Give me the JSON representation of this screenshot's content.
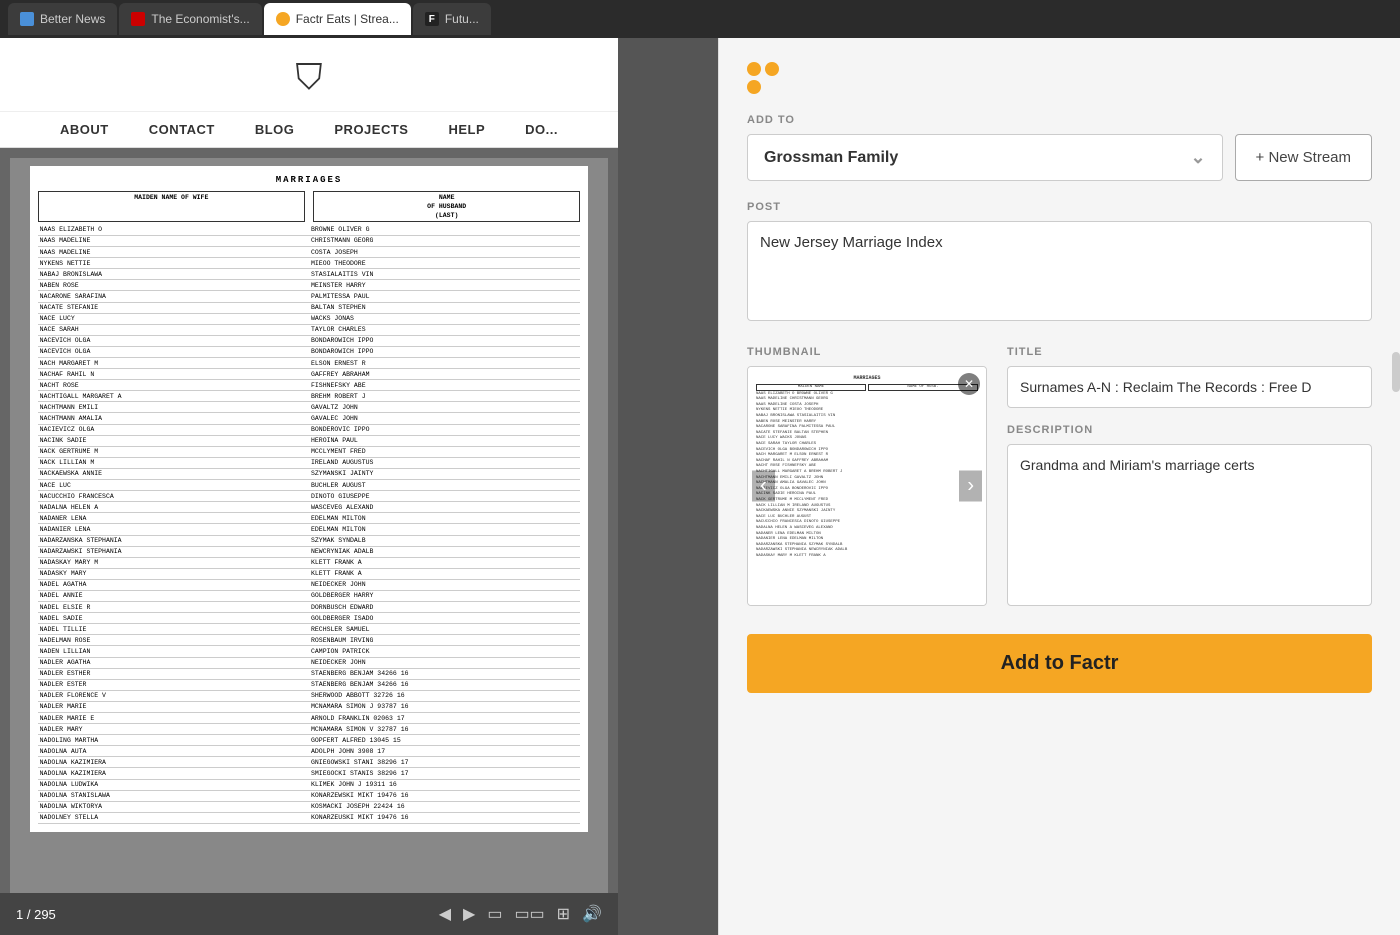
{
  "tabs": [
    {
      "id": "tab1",
      "label": "Better News",
      "icon_color": "#4a90d9",
      "active": false
    },
    {
      "id": "tab2",
      "label": "The Economist's...",
      "icon_color": "#cc0000",
      "active": false
    },
    {
      "id": "tab3",
      "label": "Factr Eats | Strea...",
      "icon_color": "#f5a623",
      "active": true
    },
    {
      "id": "tab4",
      "label": "Futu...",
      "icon_color": "#222",
      "active": false
    }
  ],
  "site": {
    "nav_items": [
      "ABOUT",
      "CONTACT",
      "BLOG",
      "PROJECTS",
      "HELP",
      "DO..."
    ]
  },
  "document": {
    "title": "MARRIAGES",
    "subtitle": "MAIDEN NAME OF WIFE",
    "col2_header": "NAME OF HUSBAND (LAST)",
    "rows": [
      [
        "NAAS ELIZABETH O",
        "BROWNE OLIVER G"
      ],
      [
        "NAAS MADELINE",
        "CHRISTMANN GEORG"
      ],
      [
        "NAAS MADELINE",
        "COSTA JOSEPH"
      ],
      [
        "NYKENS NETTIE",
        "MIEOO THEODORE"
      ],
      [
        "NABAJ BRONISLAWA",
        "STASIALAITIS VIN"
      ],
      [
        "NABEN ROSE",
        "MEINSTER HARRY"
      ],
      [
        "NACARONE SARAFINA",
        "PALMITESSA PAUL"
      ],
      [
        "NACATE STEFANIE",
        "BALTAN STEPHEN"
      ],
      [
        "NACE LUCY",
        "WACKS JONAS"
      ],
      [
        "NACE SARAH",
        "TAYLOR CHARLES"
      ],
      [
        "NACEVICH OLGA",
        "BONDAROWICH IPPO"
      ],
      [
        "NACEVICH OLGA",
        "BONDAROWICH IPPO"
      ],
      [
        "NACH MARGARET M",
        "ELSON ERNEST R"
      ],
      [
        "NACHAF RAHIL N",
        "GAFFREY ABRAHAM"
      ],
      [
        "NACHT ROSE",
        "FISHNEFSKY ABE"
      ],
      [
        "NACHTIGALL MARGARET A",
        "BREHM ROBERT J"
      ],
      [
        "NACHTMANN EMILI",
        "GAVALTZ JOHN"
      ],
      [
        "NACHTMANN AMALIA",
        "GAVALEC JOHN"
      ],
      [
        "NACIEVICZ OLGA",
        "BONDEROVIC IPPO"
      ],
      [
        "NACINK SADIE",
        "HEROINA PAUL"
      ],
      [
        "NACK GERTRUME M",
        "MCCLYMENT FRED"
      ],
      [
        "NACK LILLIAN M",
        "IRELAND AUGUSTUS"
      ],
      [
        "NACKAEWSKA ANNIE",
        "SZYMANSKI JAINTY"
      ],
      [
        "NACE LUC",
        "BUCHLER AUGUST"
      ],
      [
        "NACUCCHIO FRANCESCA",
        "DINOTO GIUSEPPE"
      ],
      [
        "NADALNA HELEN A",
        "WASCEVEG ALEXAND"
      ],
      [
        "NADANER LENA",
        "EDELMAN MILTON"
      ],
      [
        "NADANIER LENA",
        "EDELMAN MILTON"
      ],
      [
        "NADARZANSKA STEPHANIA",
        "SZYMAK SYNDALB"
      ],
      [
        "NADARZAWSKI STEPHANIA",
        "NEWCRYNIAK ADALB"
      ],
      [
        "NADASKAY MARY M",
        "KLETT FRANK A"
      ],
      [
        "NADASKY MARY",
        "KLETT FRANK A"
      ],
      [
        "NADEL AGATHA",
        "NEIDECKER JOHN"
      ],
      [
        "NADEL ANNIE",
        "GOLDBERGER HARRY"
      ],
      [
        "NADEL ELSIE R",
        "DORNBUSCH EDWARD"
      ],
      [
        "NADEL SADIE",
        "GOLDBERGER ISADO"
      ],
      [
        "NADEL TILLIE",
        "RECHSLER SAMUEL"
      ],
      [
        "NADELMAN ROSE",
        "ROSENBAUM IRVING"
      ],
      [
        "NADEN LILLIAN",
        "CAMPION PATRICK"
      ],
      [
        "NADLER AGATHA",
        "NEIDECKER JOHN"
      ],
      [
        "NADLER ESTHER",
        "STAENBERG BENJAM 34266   16"
      ],
      [
        "NADLER ESTER",
        "STAENBERG BENJAM 34266   16"
      ],
      [
        "NADLER FLORENCE V",
        "SHERWOOD ABBOTT  32726   16"
      ],
      [
        "NADLER MARIE",
        "MCNAMARA SIMON J  93787   16"
      ],
      [
        "NADLER MARIE E",
        "ARNOLD FRANKLIN   02063   17"
      ],
      [
        "NADLER MARY",
        "MCNAMARA SIMON V  32787   16"
      ],
      [
        "NADOLING MARTHA",
        "GOPFERT ALFRED  13045   15"
      ],
      [
        "NADOLNA AUTA",
        "ADOLPH JOHN       3908   17"
      ],
      [
        "NADOLNA KAZIMIERA",
        "GNIEGOWSKI STANI 38296   17"
      ],
      [
        "NADOLNA KAZIMIERA",
        "SMIEGOCKI STANIS 38296   17"
      ],
      [
        "NADOLNA LUDWIKA",
        "KLIMEK JOHN J    19311   16"
      ],
      [
        "NADOLNA STANISLAWA",
        "KONARZEWSKI MIKT 19476   16"
      ],
      [
        "NADOLNA WIKTORYA",
        "KOSMACKI JOSEPH  22424   16"
      ],
      [
        "NADOLNEY STELLA",
        "KONARZEUSKI MIKT 19476   16"
      ]
    ],
    "page_current": 1,
    "page_total": 295
  },
  "factr": {
    "logo_alt": "Factr Logo",
    "add_to_label": "ADD TO",
    "stream_name": "Grossman Family",
    "new_stream_label": "+ New Stream",
    "post_label": "POST",
    "post_value": "New Jersey Marriage Index",
    "thumbnail_label": "THUMBNAIL",
    "title_label": "TITLE",
    "title_value": "Surnames A-N : Reclaim The Records : Free D",
    "description_label": "DESCRIPTION",
    "description_value": "Grandma and Miriam's marriage certs",
    "add_button_label": "Add to Factr"
  }
}
